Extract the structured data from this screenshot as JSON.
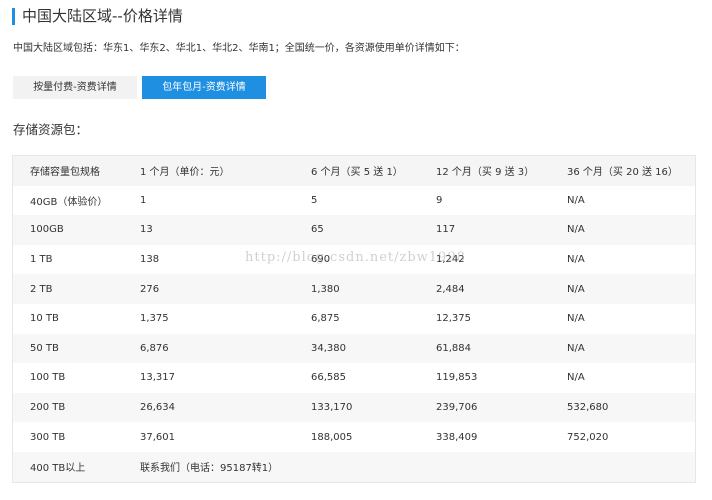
{
  "header": {
    "title": "中国大陆区域--价格详情",
    "intro": "中国大陆区域包括：华东1、华东2、华北1、华北2、华南1；全国统一价，各资源使用单价详情如下："
  },
  "tabs": [
    {
      "label": "按量付费-资费详情",
      "active": false
    },
    {
      "label": "包年包月-资费详情",
      "active": true
    }
  ],
  "section": {
    "heading": "存储资源包："
  },
  "table": {
    "headers": [
      "存储容量包规格",
      "1 个月（单价：元）",
      "6 个月（买 5 送 1）",
      "12 个月（买 9 送 3）",
      "36 个月（买 20 送 16）"
    ],
    "rows": [
      [
        "40GB（体验价）",
        "1",
        "5",
        "9",
        "N/A"
      ],
      [
        "100GB",
        "13",
        "65",
        "117",
        "N/A"
      ],
      [
        "1 TB",
        "138",
        "690",
        "1,242",
        "N/A"
      ],
      [
        "2 TB",
        "276",
        "1,380",
        "2,484",
        "N/A"
      ],
      [
        "10 TB",
        "1,375",
        "6,875",
        "12,375",
        "N/A"
      ],
      [
        "50 TB",
        "6,876",
        "34,380",
        "61,884",
        "N/A"
      ],
      [
        "100 TB",
        "13,317",
        "66,585",
        "119,853",
        "N/A"
      ],
      [
        "200 TB",
        "26,634",
        "133,170",
        "239,706",
        "532,680"
      ],
      [
        "300 TB",
        "37,601",
        "188,005",
        "338,409",
        "752,020"
      ],
      [
        "400 TB以上",
        "联系我们（电话：95187转1）",
        "",
        "",
        ""
      ]
    ]
  },
  "watermark": "http://blog.csdn.net/zbw1998",
  "colors": {
    "accent": "#1e8fe1",
    "header_row_bg": "#f5f5f5",
    "stripe_bg": "#f7f7f7",
    "inactive_tab_bg": "#f2f2f2"
  }
}
